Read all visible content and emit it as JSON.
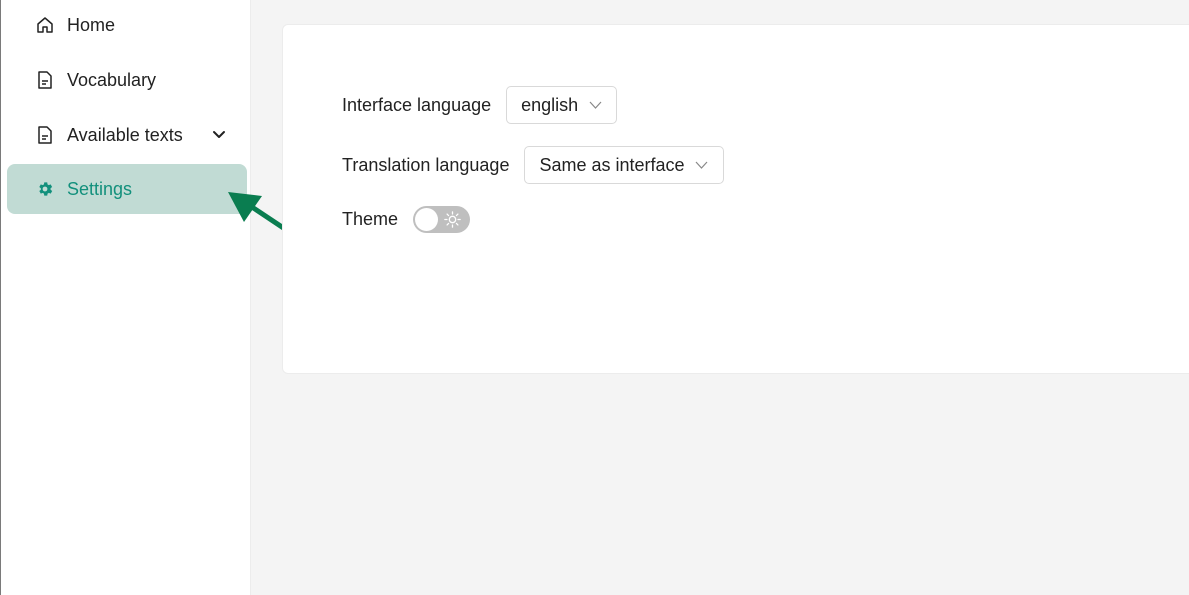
{
  "sidebar": {
    "items": [
      {
        "label": "Home",
        "icon": "home-icon"
      },
      {
        "label": "Vocabulary",
        "icon": "document-icon"
      },
      {
        "label": "Available texts",
        "icon": "document-icon",
        "expandable": true
      },
      {
        "label": "Settings",
        "icon": "gear-icon",
        "active": true
      }
    ]
  },
  "settings": {
    "interface_language": {
      "label": "Interface language",
      "value": "english"
    },
    "translation_language": {
      "label": "Translation language",
      "value": "Same as interface"
    },
    "theme": {
      "label": "Theme",
      "state": "light",
      "icon": "sun-icon"
    }
  },
  "colors": {
    "accent": "#12907c",
    "active_bg": "#c1dbd4",
    "annotation_arrow": "#0a7d50",
    "toggle_track": "#bfbfbf"
  }
}
